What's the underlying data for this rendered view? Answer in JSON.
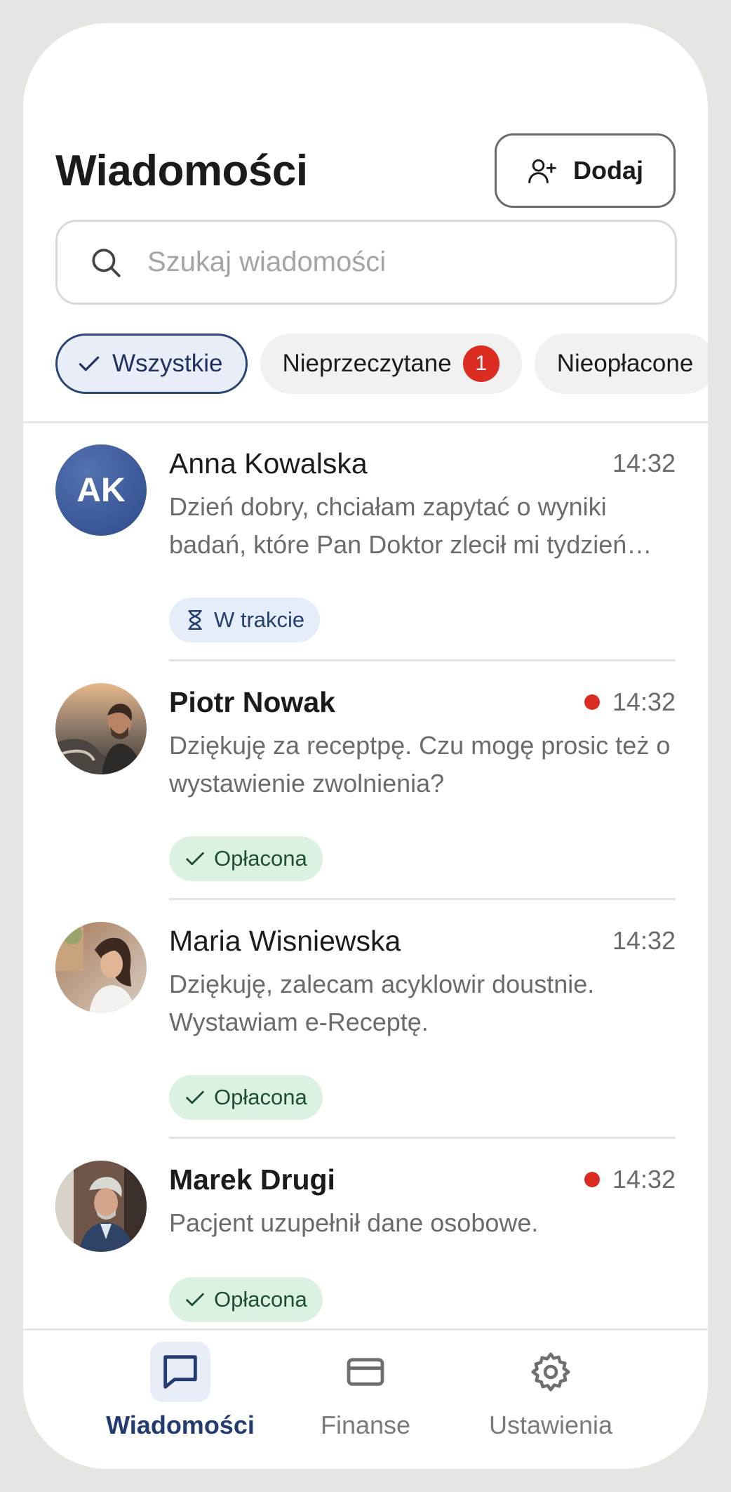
{
  "header": {
    "title": "Wiadomości",
    "add_label": "Dodaj"
  },
  "search": {
    "placeholder": "Szukaj wiadomości"
  },
  "filters": [
    {
      "label": "Wszystkie",
      "active": true
    },
    {
      "label": "Nieprzeczytane",
      "count": "1"
    },
    {
      "label": "Nieopłacone"
    }
  ],
  "messages": [
    {
      "initials": "AK",
      "name": "Anna Kowalska",
      "time": "14:32",
      "unread": false,
      "preview": "Dzień dobry, chciałam zapytać o wyniki badań, które Pan Doktor zlecił mi tydzień temu.",
      "status": "W trakcie"
    },
    {
      "name": "Piotr Nowak",
      "time": "14:32",
      "unread": true,
      "preview": "Dziękuję za receptpę. Czu mogę prosic też o wystawienie zwolnienia?",
      "status": "Opłacona"
    },
    {
      "name": "Maria Wisniewska",
      "time": "14:32",
      "unread": false,
      "preview": "Dziękuję, zalecam acyklowir doustnie. Wystawiam e-Receptę.",
      "status": "Opłacona"
    },
    {
      "name": "Marek Drugi",
      "time": "14:32",
      "unread": true,
      "preview": "Pacjent uzupełnił dane osobowe.",
      "status": "Opłacona"
    }
  ],
  "nav": [
    {
      "label": "Wiadomości",
      "icon": "chat-bubble-icon",
      "active": true
    },
    {
      "label": "Finanse",
      "icon": "credit-card-icon"
    },
    {
      "label": "Ustawienia",
      "icon": "gear-icon"
    }
  ],
  "colors": {
    "accent": "#223b73",
    "unread_dot": "#dc2b21",
    "status_progress_bg": "#e5edf8",
    "status_paid_bg": "#dbf2e2"
  }
}
